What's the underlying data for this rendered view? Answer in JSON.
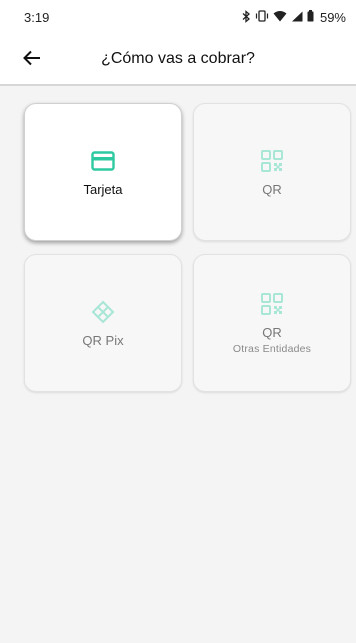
{
  "status_bar": {
    "time": "3:19",
    "battery": "59%",
    "icons": [
      "bluetooth-icon",
      "vibrate-icon",
      "wifi-icon",
      "signal-icon",
      "battery-icon"
    ]
  },
  "app_bar": {
    "title": "¿Cómo vas a cobrar?",
    "back_icon": "arrow-left-icon"
  },
  "options": [
    {
      "label": "Tarjeta",
      "sublabel": "",
      "icon": "card-icon",
      "selected": true,
      "color": "#2ec9a0"
    },
    {
      "label": "QR",
      "sublabel": "",
      "icon": "qr-icon",
      "selected": false,
      "color": "#a8e6d6"
    },
    {
      "label": "QR Pix",
      "sublabel": "",
      "icon": "pix-icon",
      "selected": false,
      "color": "#a8e6d6"
    },
    {
      "label": "QR",
      "sublabel": "Otras Entidades",
      "icon": "qr-icon",
      "selected": false,
      "color": "#a8e6d6"
    }
  ],
  "colors": {
    "accent": "#2ec9a0",
    "accent_light": "#a8e6d6",
    "background": "#f4f4f4"
  }
}
